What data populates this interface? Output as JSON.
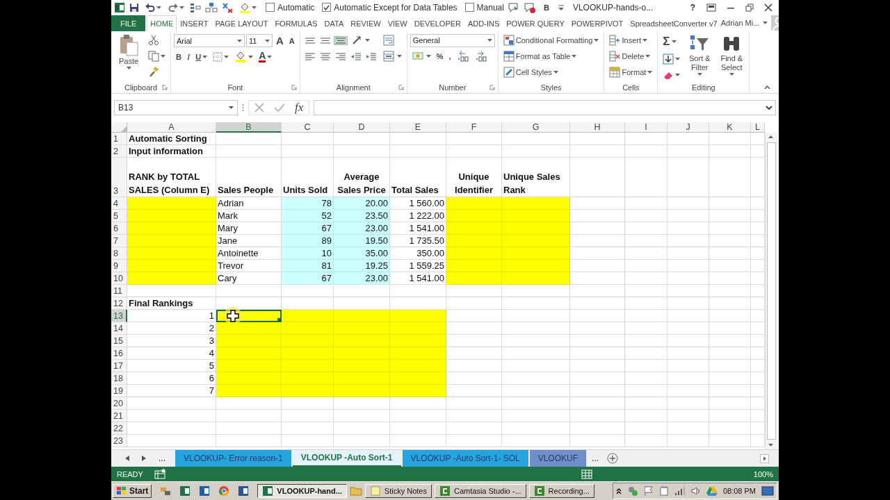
{
  "title_bar": {
    "checkboxes": [
      {
        "label": "Automatic",
        "checked": false
      },
      {
        "label": "Automatic Except for Data Tables",
        "checked": true
      },
      {
        "label": "Manual",
        "checked": false
      }
    ],
    "bold_label": "B",
    "document_title": "VLOOKUP-hands-o...",
    "help": "?"
  },
  "ribbon": {
    "tabs": [
      {
        "label": "FILE",
        "kind": "file",
        "selected": false
      },
      {
        "label": "HOME",
        "kind": "tab",
        "selected": true
      },
      {
        "label": "INSERT",
        "kind": "tab",
        "selected": false
      },
      {
        "label": "PAGE LAYOUT",
        "kind": "tab",
        "selected": false
      },
      {
        "label": "FORMULAS",
        "kind": "tab",
        "selected": false
      },
      {
        "label": "DATA",
        "kind": "tab",
        "selected": false
      },
      {
        "label": "REVIEW",
        "kind": "tab",
        "selected": false
      },
      {
        "label": "VIEW",
        "kind": "tab",
        "selected": false
      },
      {
        "label": "DEVELOPER",
        "kind": "tab",
        "selected": false
      },
      {
        "label": "ADD-INS",
        "kind": "tab",
        "selected": false
      },
      {
        "label": "POWER QUERY",
        "kind": "tab",
        "selected": false
      },
      {
        "label": "POWERPIVOT",
        "kind": "tab",
        "selected": false
      },
      {
        "label": "SpreadsheetConverter v7",
        "kind": "tab",
        "selected": false
      }
    ],
    "user": "Adrian Mi...",
    "groups": [
      {
        "label": "Clipboard",
        "launcher": true,
        "blocks": [
          {
            "kind": "large",
            "item": {
              "kind": "paste",
              "label": "Paste"
            }
          },
          {
            "kind": "stack",
            "lines": [
              {
                "items": [
                  {
                    "kind": "cut"
                  }
                ]
              },
              {
                "items": [
                  {
                    "kind": "copy"
                  }
                ]
              },
              {
                "items": [
                  {
                    "kind": "painter"
                  }
                ]
              }
            ]
          }
        ]
      },
      {
        "label": "Font",
        "launcher": true,
        "blocks": [
          {
            "kind": "stack",
            "lines": [
              {
                "items": [
                  {
                    "kind": "font-box",
                    "value": "Arial"
                  },
                  {
                    "kind": "size-box",
                    "value": "11"
                  },
                  {
                    "kind": "grow",
                    "label": "A"
                  },
                  {
                    "kind": "shrink",
                    "label": "A"
                  }
                ]
              },
              {
                "items": [
                  {
                    "kind": "bold",
                    "label": "B"
                  },
                  {
                    "kind": "italic",
                    "label": "I"
                  },
                  {
                    "kind": "underline",
                    "label": "U"
                  },
                  {
                    "kind": "borders"
                  },
                  {
                    "kind": "fill-color"
                  },
                  {
                    "kind": "font-color",
                    "label": "A"
                  }
                ]
              }
            ]
          }
        ]
      },
      {
        "label": "Alignment",
        "launcher": true,
        "blocks": [
          {
            "kind": "stack",
            "lines": [
              {
                "items": [
                  {
                    "kind": "align-top",
                    "selected": false
                  },
                  {
                    "kind": "align-middle",
                    "selected": false
                  },
                  {
                    "kind": "align-bottom",
                    "selected": true
                  },
                  {
                    "kind": "orientation"
                  }
                ]
              },
              {
                "items": [
                  {
                    "kind": "align-left",
                    "selected": false
                  },
                  {
                    "kind": "align-center",
                    "selected": false
                  },
                  {
                    "kind": "align-right",
                    "selected": false
                  },
                  {
                    "kind": "outdent"
                  },
                  {
                    "kind": "indent"
                  }
                ]
              }
            ]
          },
          {
            "kind": "stack",
            "lines": [
              {
                "items": [
                  {
                    "kind": "wrap"
                  }
                ]
              },
              {
                "items": [
                  {
                    "kind": "merge"
                  }
                ]
              }
            ]
          }
        ]
      },
      {
        "label": "Number",
        "launcher": true,
        "blocks": [
          {
            "kind": "stack",
            "lines": [
              {
                "items": [
                  {
                    "kind": "format-box",
                    "value": "General"
                  }
                ]
              },
              {
                "items": [
                  {
                    "kind": "currency"
                  },
                  {
                    "kind": "percent",
                    "label": "%"
                  },
                  {
                    "kind": "comma",
                    "label": ","
                  },
                  {
                    "kind": "inc-decimal"
                  },
                  {
                    "kind": "dec-decimal"
                  }
                ]
              }
            ]
          }
        ]
      },
      {
        "label": "Styles",
        "launcher": false,
        "blocks": [
          {
            "kind": "stack",
            "lines": [
              {
                "items": [
                  {
                    "kind": "conditional",
                    "label": "Conditional Formatting"
                  }
                ]
              },
              {
                "items": [
                  {
                    "kind": "table",
                    "label": "Format as Table"
                  }
                ]
              },
              {
                "items": [
                  {
                    "kind": "cell-styles",
                    "label": "Cell Styles"
                  }
                ]
              }
            ]
          }
        ]
      },
      {
        "label": "Cells",
        "launcher": false,
        "blocks": [
          {
            "kind": "stack",
            "lines": [
              {
                "items": [
                  {
                    "kind": "insert",
                    "label": "Insert"
                  }
                ]
              },
              {
                "items": [
                  {
                    "kind": "delete",
                    "label": "Delete"
                  }
                ]
              },
              {
                "items": [
                  {
                    "kind": "format",
                    "label": "Format"
                  }
                ]
              }
            ]
          }
        ]
      },
      {
        "label": "Editing",
        "launcher": false,
        "blocks": [
          {
            "kind": "stack",
            "lines": [
              {
                "items": [
                  {
                    "kind": "autosum",
                    "label": "Σ"
                  }
                ]
              },
              {
                "items": [
                  {
                    "kind": "fill-down"
                  }
                ]
              },
              {
                "items": [
                  {
                    "kind": "clear"
                  }
                ]
              }
            ]
          },
          {
            "kind": "large",
            "item": {
              "kind": "sort",
              "label": "Sort & Filter"
            }
          },
          {
            "kind": "large",
            "item": {
              "kind": "find",
              "label": "Find & Select"
            }
          }
        ]
      }
    ]
  },
  "formula_bar": {
    "name_box": "B13",
    "function_label": "fx"
  },
  "sheet": {
    "columns": [
      {
        "label": "A",
        "selected": false
      },
      {
        "label": "B",
        "selected": true
      },
      {
        "label": "C",
        "selected": false
      },
      {
        "label": "D",
        "selected": false
      },
      {
        "label": "E",
        "selected": false
      },
      {
        "label": "F",
        "selected": false
      },
      {
        "label": "G",
        "selected": false
      },
      {
        "label": "H",
        "selected": false
      },
      {
        "label": "I",
        "selected": false
      },
      {
        "label": "J",
        "selected": false
      },
      {
        "label": "K",
        "selected": false
      },
      {
        "label": "L",
        "selected": false
      }
    ],
    "rows": [
      {
        "label": "1",
        "selected": false,
        "cells": [
          {
            "text": "Automatic Sorting",
            "bold": true
          }
        ]
      },
      {
        "label": "2",
        "selected": false,
        "cells": [
          {
            "text": "Input information",
            "bold": true
          }
        ]
      },
      {
        "label": "3",
        "selected": false,
        "cells": [
          {
            "text": "RANK by TOTAL SALES (Column E)",
            "bold": true,
            "wrap": true
          },
          {
            "text": "Sales People",
            "bold": true,
            "wrap": true
          },
          {
            "text": "Units Sold",
            "bold": true,
            "wrap": true
          },
          {
            "text": "Average Sales Price",
            "bold": true,
            "wrap": true,
            "kind": "centered"
          },
          {
            "text": "Total Sales",
            "bold": true,
            "wrap": true
          },
          {
            "text": "Unique Identifier",
            "bold": true,
            "wrap": true,
            "kind": "centered"
          },
          {
            "text": "Unique Sales Rank",
            "bold": true,
            "wrap": true
          }
        ]
      },
      {
        "label": "4",
        "selected": false,
        "cells": [
          {
            "color": "#ffff00"
          },
          {
            "text": "Adrian"
          },
          {
            "text": "78",
            "kind": "number",
            "color": "#ccffff"
          },
          {
            "text": "20.00",
            "kind": "number",
            "color": "#ccffff"
          },
          {
            "text": "1 560.00",
            "kind": "number"
          },
          {
            "color": "#ffff00"
          },
          {
            "color": "#ffff00"
          }
        ]
      },
      {
        "label": "5",
        "selected": false,
        "cells": [
          {
            "color": "#ffff00"
          },
          {
            "text": "Mark"
          },
          {
            "text": "52",
            "kind": "number",
            "color": "#ccffff"
          },
          {
            "text": "23.50",
            "kind": "number",
            "color": "#ccffff"
          },
          {
            "text": "1 222.00",
            "kind": "number"
          },
          {
            "color": "#ffff00"
          },
          {
            "color": "#ffff00"
          }
        ]
      },
      {
        "label": "6",
        "selected": false,
        "cells": [
          {
            "color": "#ffff00"
          },
          {
            "text": "Mary"
          },
          {
            "text": "67",
            "kind": "number",
            "color": "#ccffff"
          },
          {
            "text": "23.00",
            "kind": "number",
            "color": "#ccffff"
          },
          {
            "text": "1 541.00",
            "kind": "number"
          },
          {
            "color": "#ffff00"
          },
          {
            "color": "#ffff00"
          }
        ]
      },
      {
        "label": "7",
        "selected": false,
        "cells": [
          {
            "color": "#ffff00"
          },
          {
            "text": "Jane"
          },
          {
            "text": "89",
            "kind": "number",
            "color": "#ccffff"
          },
          {
            "text": "19.50",
            "kind": "number",
            "color": "#ccffff"
          },
          {
            "text": "1 735.50",
            "kind": "number"
          },
          {
            "color": "#ffff00"
          },
          {
            "color": "#ffff00"
          }
        ]
      },
      {
        "label": "8",
        "selected": false,
        "cells": [
          {
            "color": "#ffff00"
          },
          {
            "text": "Antoinette"
          },
          {
            "text": "10",
            "kind": "number",
            "color": "#ccffff"
          },
          {
            "text": "35.00",
            "kind": "number",
            "color": "#ccffff"
          },
          {
            "text": "350.00",
            "kind": "number"
          },
          {
            "color": "#ffff00"
          },
          {
            "color": "#ffff00"
          }
        ]
      },
      {
        "label": "9",
        "selected": false,
        "cells": [
          {
            "color": "#ffff00"
          },
          {
            "text": "Trevor"
          },
          {
            "text": "81",
            "kind": "number",
            "color": "#ccffff"
          },
          {
            "text": "19.25",
            "kind": "number",
            "color": "#ccffff"
          },
          {
            "text": "1 559.25",
            "kind": "number"
          },
          {
            "color": "#ffff00"
          },
          {
            "color": "#ffff00"
          }
        ]
      },
      {
        "label": "10",
        "selected": false,
        "cells": [
          {
            "color": "#ffff00"
          },
          {
            "text": "Cary"
          },
          {
            "text": "67",
            "kind": "number",
            "color": "#ccffff"
          },
          {
            "text": "23.00",
            "kind": "number",
            "color": "#ccffff"
          },
          {
            "text": "1 541.00",
            "kind": "number"
          },
          {
            "color": "#ffff00"
          },
          {
            "color": "#ffff00"
          }
        ]
      },
      {
        "label": "11",
        "selected": false
      },
      {
        "label": "12",
        "selected": false,
        "cells": [
          {
            "text": "Final Rankings",
            "bold": true
          }
        ]
      },
      {
        "label": "13",
        "selected": true,
        "cells": [
          {
            "text": "1",
            "kind": "number"
          },
          {
            "color": "#ffff00"
          },
          {
            "color": "#ffff00"
          },
          {
            "color": "#ffff00"
          },
          {
            "color": "#ffff00"
          }
        ]
      },
      {
        "label": "14",
        "selected": false,
        "cells": [
          {
            "text": "2",
            "kind": "number"
          },
          {
            "color": "#ffff00"
          },
          {
            "color": "#ffff00"
          },
          {
            "color": "#ffff00"
          },
          {
            "color": "#ffff00"
          }
        ]
      },
      {
        "label": "15",
        "selected": false,
        "cells": [
          {
            "text": "3",
            "kind": "number"
          },
          {
            "color": "#ffff00"
          },
          {
            "color": "#ffff00"
          },
          {
            "color": "#ffff00"
          },
          {
            "color": "#ffff00"
          }
        ]
      },
      {
        "label": "16",
        "selected": false,
        "cells": [
          {
            "text": "4",
            "kind": "number"
          },
          {
            "color": "#ffff00"
          },
          {
            "color": "#ffff00"
          },
          {
            "color": "#ffff00"
          },
          {
            "color": "#ffff00"
          }
        ]
      },
      {
        "label": "17",
        "selected": false,
        "cells": [
          {
            "text": "5",
            "kind": "number"
          },
          {
            "color": "#ffff00"
          },
          {
            "color": "#ffff00"
          },
          {
            "color": "#ffff00"
          },
          {
            "color": "#ffff00"
          }
        ]
      },
      {
        "label": "18",
        "selected": false,
        "cells": [
          {
            "text": "6",
            "kind": "number"
          },
          {
            "color": "#ffff00"
          },
          {
            "color": "#ffff00"
          },
          {
            "color": "#ffff00"
          },
          {
            "color": "#ffff00"
          }
        ]
      },
      {
        "label": "19",
        "selected": false,
        "cells": [
          {
            "text": "7",
            "kind": "number"
          },
          {
            "color": "#ffff00"
          },
          {
            "color": "#ffff00"
          },
          {
            "color": "#ffff00"
          },
          {
            "color": "#ffff00"
          }
        ]
      },
      {
        "label": "20",
        "selected": false
      },
      {
        "label": "21",
        "selected": false
      },
      {
        "label": "22",
        "selected": false
      },
      {
        "label": "23",
        "selected": false
      }
    ]
  },
  "sheet_tabs": {
    "more_left": "...",
    "tabs": [
      {
        "label": "VLOOKUP- Error reason-1",
        "selected": false,
        "color": "#25a4e0"
      },
      {
        "label": "VLOOKUP -Auto Sort-1",
        "selected": true,
        "color": "#e6f2fa"
      },
      {
        "label": "VLOOKUP -Auto Sort-1- SOL",
        "selected": false,
        "color": "#25a4e0"
      },
      {
        "label": "VLOOKUF",
        "selected": false,
        "color": "#6f8fc8"
      }
    ],
    "more_right": "..."
  },
  "status_bar": {
    "mode": "READY",
    "zoom": "100%"
  },
  "taskbar": {
    "start": "Start",
    "tasks": [
      {
        "label": "VLOOKUP-hand...",
        "kind": "excel",
        "selected": true
      },
      {
        "label": "Sticky Notes",
        "kind": "notes",
        "selected": false
      },
      {
        "label": "Camtasia Studio -...",
        "kind": "camtasia",
        "selected": false
      },
      {
        "label": "Recording...",
        "kind": "camtasia",
        "selected": false
      }
    ],
    "clock": "08:08 PM"
  }
}
